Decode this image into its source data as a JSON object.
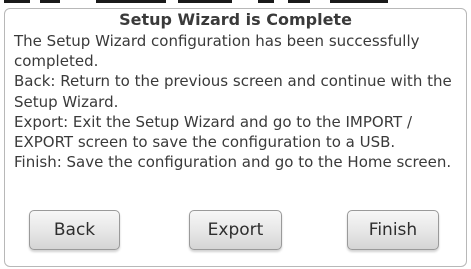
{
  "dialog": {
    "title": "Setup Wizard is Complete",
    "message_lines": [
      "The Setup Wizard configuration has been successfully completed.",
      "Back: Return to the previous screen and continue with the Setup Wizard.",
      "Export: Exit the Setup Wizard and go to the IMPORT / EXPORT screen to save the configuration to a USB.",
      "Finish: Save the configuration and go to the Home screen."
    ],
    "buttons": {
      "back_label": "Back",
      "export_label": "Export",
      "finish_label": "Finish"
    }
  },
  "colors": {
    "text": "#3a3a3a",
    "dialog_border": "#b8b8b8",
    "button_top": "#f7f7f7",
    "button_bottom": "#d5d5d5"
  }
}
